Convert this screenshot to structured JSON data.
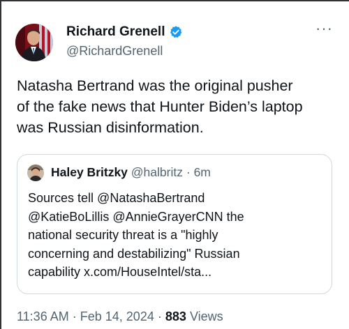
{
  "tweet": {
    "author_name": "Richard Grenell",
    "author_handle": "@RichardGrenell",
    "verified": true,
    "more_glyph": "···",
    "text_lines": [
      "Natasha Bertrand was the original pusher",
      "of the fake news that Hunter Biden’s laptop",
      "was Russian disinformation."
    ],
    "time": "11:36 AM",
    "date": "Feb 14, 2024",
    "views_count": "883",
    "views_label": "Views",
    "separator": "·"
  },
  "quote": {
    "author_name": "Haley Britzky",
    "author_handle": "@halbritz",
    "age": "6m",
    "separator": "·",
    "text_lines": [
      "Sources tell @NatashaBertrand",
      "@KatieBoLillis @AnnieGrayerCNN the",
      "national security threat is a \"highly",
      "concerning and destabilizing\" Russian",
      "capability x.com/HouseIntel/sta..."
    ]
  },
  "colors": {
    "verified_blue": "#1d9bf0",
    "secondary_text": "#536471",
    "primary_text": "#0f1419",
    "border": "#cfd9de"
  }
}
